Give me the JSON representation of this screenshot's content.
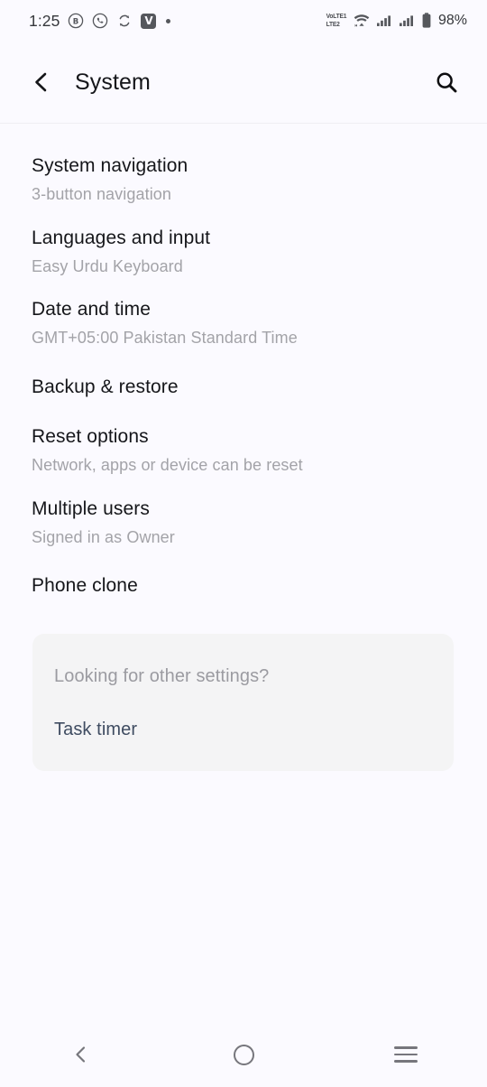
{
  "status_bar": {
    "time": "1:25",
    "left_icons": [
      {
        "name": "bitcoin-b-circle-icon",
        "glyph": "B"
      },
      {
        "name": "whatsapp-icon",
        "glyph": "whatsapp"
      },
      {
        "name": "sync-icon",
        "glyph": "sync"
      },
      {
        "name": "v-app-icon",
        "glyph": "V"
      },
      {
        "name": "notification-dot-icon",
        "glyph": "dot"
      }
    ],
    "volte_line1": "VoLTE1",
    "volte_line2": "LTE2",
    "right_icons": [
      {
        "name": "volte-dual-sim-icon"
      },
      {
        "name": "wifi-icon"
      },
      {
        "name": "signal-sim1-icon"
      },
      {
        "name": "signal-sim2-icon"
      },
      {
        "name": "battery-icon"
      }
    ],
    "battery_percent": "98%"
  },
  "header": {
    "back_label": "Back",
    "title": "System",
    "search_label": "Search"
  },
  "settings": {
    "items": [
      {
        "title": "System navigation",
        "subtitle": "3-button navigation",
        "key": "system-navigation"
      },
      {
        "title": "Languages and input",
        "subtitle": "Easy Urdu Keyboard",
        "key": "languages-and-input"
      },
      {
        "title": "Date and time",
        "subtitle": "GMT+05:00 Pakistan Standard Time",
        "key": "date-and-time"
      },
      {
        "title": "Backup & restore",
        "subtitle": "",
        "key": "backup-and-restore"
      },
      {
        "title": "Reset options",
        "subtitle": "Network, apps or device can be reset",
        "key": "reset-options"
      },
      {
        "title": "Multiple users",
        "subtitle": "Signed in as Owner",
        "key": "multiple-users"
      },
      {
        "title": "Phone clone",
        "subtitle": "",
        "key": "phone-clone"
      }
    ]
  },
  "suggestion_card": {
    "question": "Looking for other settings?",
    "link": "Task timer"
  },
  "nav_bar": {
    "back_label": "Back",
    "home_label": "Home",
    "recents_label": "Recents"
  },
  "colors": {
    "page_background": "#fbfaff",
    "card_background": "#f4f4f5",
    "title_text": "#15161a",
    "subtitle_text": "#a3a3a8",
    "link_text": "#3f4c61",
    "nav_icon": "#76767c"
  }
}
